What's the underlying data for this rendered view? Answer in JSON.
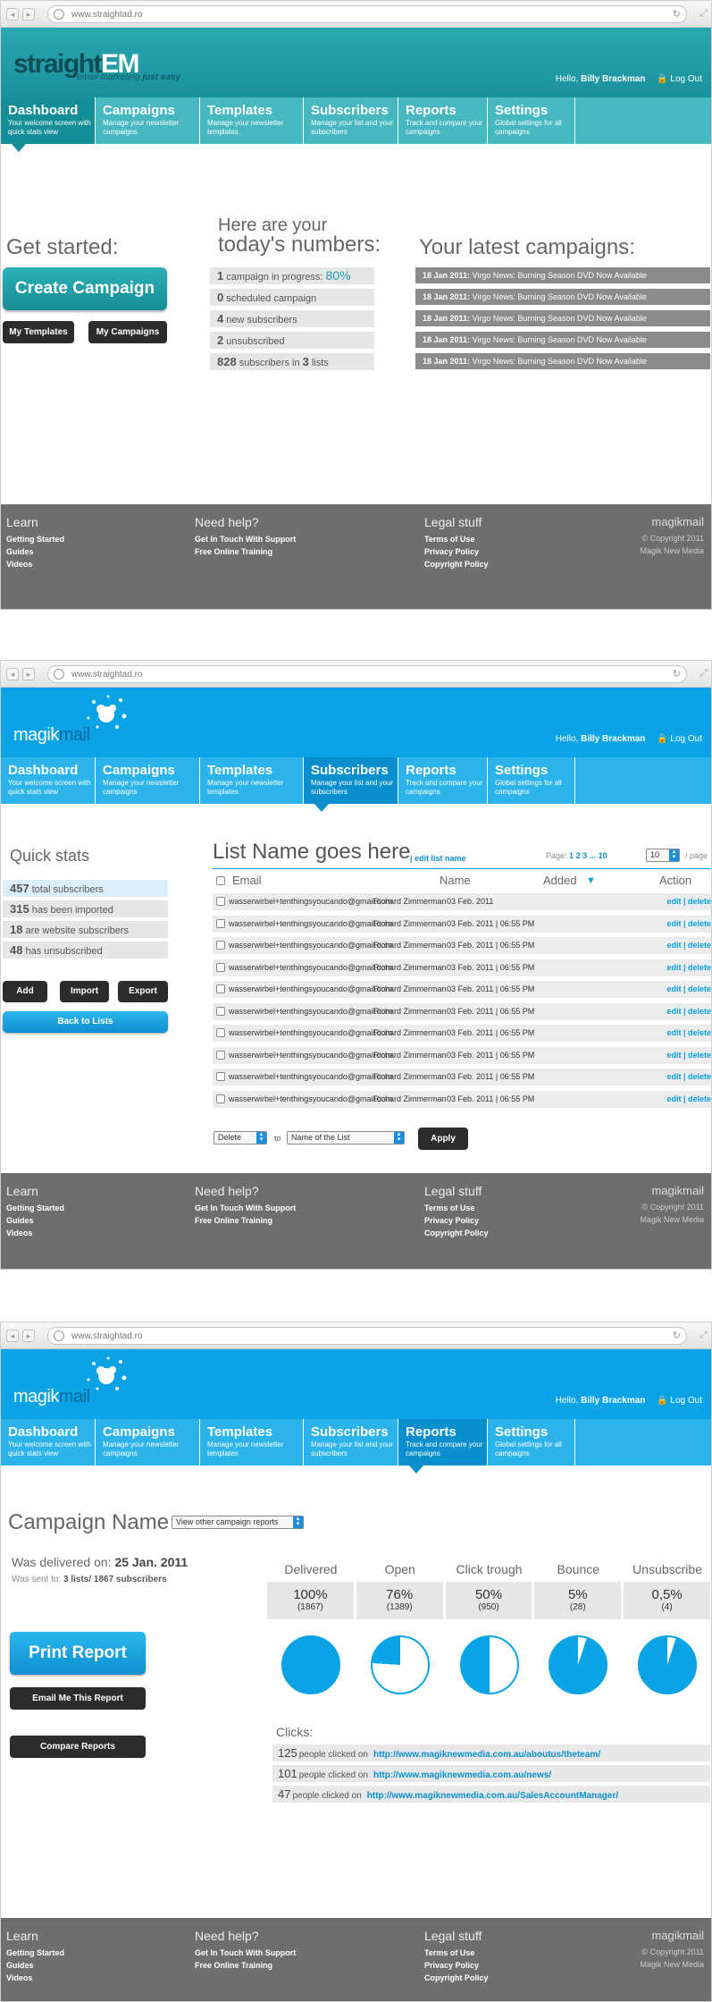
{
  "browser": {
    "url": "www.straightad.ro",
    "back": "◂",
    "fwd": "▸",
    "reload": "↻",
    "expand": "⤢"
  },
  "user": {
    "hello": "Hello,",
    "name": "Billy Brackman",
    "logout": "Log Out"
  },
  "nav": [
    {
      "title": "Dashboard",
      "sub": "Your welcome screen with quick stats view"
    },
    {
      "title": "Campaigns",
      "sub": "Manage your newsletter campaigns"
    },
    {
      "title": "Templates",
      "sub": "Manage your newsletter templates"
    },
    {
      "title": "Subscribers",
      "sub": "Manage your list and your subscribers"
    },
    {
      "title": "Reports",
      "sub": "Track and compare your campaigns"
    },
    {
      "title": "Settings",
      "sub": "Global settings for all campaigns"
    }
  ],
  "footer": {
    "learn": {
      "title": "Learn",
      "links": [
        "Getting Started",
        "Guides",
        "Videos"
      ]
    },
    "help": {
      "title": "Need help?",
      "links": [
        "Get In Touch With Support",
        "Free Online Training"
      ]
    },
    "legal": {
      "title": "Legal stuff",
      "links": [
        "Terms of Use",
        "Privacy Policy",
        "Copyright Policy"
      ]
    },
    "brand": {
      "name": "magikmail",
      "copyright": "© Copyright 2011",
      "company": "Magik New Media"
    }
  },
  "screen1": {
    "logo": {
      "straight": "straight",
      "em": "EM",
      "tag1": "email marketing",
      "tag2": "just easy"
    },
    "get_started": "Get started:",
    "create_campaign": "Create Campaign",
    "my_templates": "My Templates",
    "my_campaigns": "My Campaigns",
    "numbers_heading1": "Here are your",
    "numbers_heading2": "today's numbers:",
    "stats": [
      {
        "n": "1",
        "label": "campaign in progress:",
        "pct": "80%"
      },
      {
        "n": "0",
        "label": "scheduled campaign",
        "pct": ""
      },
      {
        "n": "4",
        "label": "new subscribers",
        "pct": ""
      },
      {
        "n": "2",
        "label": "unsubscribed",
        "pct": ""
      },
      {
        "n": "828",
        "label": "subscribers in",
        "n2": "3",
        "label2": "lists"
      }
    ],
    "latest_heading": "Your latest campaigns:",
    "campaigns": [
      {
        "date": "18 Jan 2011:",
        "title": "Virgo News: Burning Season DVD Now Available"
      },
      {
        "date": "18 Jan 2011:",
        "title": "Virgo News: Burning Season DVD Now Available"
      },
      {
        "date": "18 Jan 2011:",
        "title": "Virgo News: Burning Season DVD Now Available"
      },
      {
        "date": "18 Jan 2011:",
        "title": "Virgo News: Burning Season DVD Now Available"
      },
      {
        "date": "18 Jan 2011:",
        "title": "Virgo News: Burning Season DVD Now Available"
      }
    ]
  },
  "screen2": {
    "logo": {
      "magik": "magik",
      "mail": "mail"
    },
    "quick_stats": "Quick stats",
    "stats": [
      {
        "n": "457",
        "label": "total subscribers"
      },
      {
        "n": "315",
        "label": "has been imported"
      },
      {
        "n": "18",
        "label": "are website subscribers"
      },
      {
        "n": "48",
        "label": "has unsubscribed"
      }
    ],
    "add": "Add",
    "import": "Import",
    "export": "Export",
    "back": "Back to Lists",
    "list_name": "List Name goes here",
    "edit_list": "| edit list name",
    "page_label": "Page:",
    "pages": [
      "1",
      "2",
      "3",
      "...",
      "10"
    ],
    "per_page_value": "10",
    "per_page_label": "/ page",
    "columns": {
      "email": "Email",
      "name": "Name",
      "added": "Added",
      "action": "Action"
    },
    "rows": [
      {
        "email": "wasserwirbel+tenthingsyoucando@gmail.com",
        "name": "Richard Zimmerman",
        "added": "03 Feb. 2011",
        "action": "edit | delete"
      },
      {
        "email": "wasserwirbel+tenthingsyoucando@gmail.com",
        "name": "Richard Zimmerman",
        "added": "03 Feb. 2011 | 06:55 PM",
        "action": "edit | delete"
      },
      {
        "email": "wasserwirbel+tenthingsyoucando@gmail.com",
        "name": "Richard Zimmerman",
        "added": "03 Feb. 2011 | 06:55 PM",
        "action": "edit | delete"
      },
      {
        "email": "wasserwirbel+tenthingsyoucando@gmail.com",
        "name": "Richard Zimmerman",
        "added": "03 Feb. 2011 | 06:55 PM",
        "action": "edit | delete"
      },
      {
        "email": "wasserwirbel+tenthingsyoucando@gmail.com",
        "name": "Richard Zimmerman",
        "added": "03 Feb. 2011 | 06:55 PM",
        "action": "edit | delete"
      },
      {
        "email": "wasserwirbel+tenthingsyoucando@gmail.com",
        "name": "Richard Zimmerman",
        "added": "03 Feb. 2011 | 06:55 PM",
        "action": "edit | delete"
      },
      {
        "email": "wasserwirbel+tenthingsyoucando@gmail.com",
        "name": "Richard Zimmerman",
        "added": "03 Feb. 2011 | 06:55 PM",
        "action": "edit | delete"
      },
      {
        "email": "wasserwirbel+tenthingsyoucando@gmail.com",
        "name": "Richard Zimmerman",
        "added": "03 Feb. 2011 | 06:55 PM",
        "action": "edit | delete"
      },
      {
        "email": "wasserwirbel+tenthingsyoucando@gmail.com",
        "name": "Richard Zimmerman",
        "added": "03 Feb. 2011 | 06:55 PM",
        "action": "edit | delete"
      },
      {
        "email": "wasserwirbel+tenthingsyoucando@gmail.com",
        "name": "Richard Zimmerman",
        "added": "03 Feb. 2011 | 06:55 PM",
        "action": "edit | delete"
      }
    ],
    "bulk_action": "Delete",
    "to": "to",
    "target_list": "Name of the List",
    "apply": "Apply"
  },
  "screen3": {
    "campaign_name": "Campaign Name",
    "other_reports": "View other campaign reports",
    "delivered_label": "Was delivered on:",
    "delivered_date": "25 Jan. 2011",
    "sent_label": "Was sent to:",
    "sent_value": "3 lists/ 1867 subscribers",
    "print_report": "Print Report",
    "email_report": "Email Me This Report",
    "compare_reports": "Compare Reports",
    "metrics": [
      {
        "label": "Delivered",
        "pct": "100%",
        "count": "(1867)",
        "fraction": 1.0
      },
      {
        "label": "Open",
        "pct": "76%",
        "count": "(1389)",
        "fraction": 0.76
      },
      {
        "label": "Click trough",
        "pct": "50%",
        "count": "(950)",
        "fraction": 0.5
      },
      {
        "label": "Bounce",
        "pct": "5%",
        "count": "(28)",
        "fraction": 0.05
      },
      {
        "label": "Unsubscribe",
        "pct": "0,5%",
        "count": "(4)",
        "fraction": 0.05
      }
    ],
    "clicks_label": "Clicks:",
    "clicks": [
      {
        "n": "125",
        "text": "people clicked on",
        "url": "http://www.magiknewmedia.com.au/aboutus/theteam/"
      },
      {
        "n": "101",
        "text": "people clicked on",
        "url": "http://www.magiknewmedia.com.au/news/"
      },
      {
        "n": "47",
        "text": "people clicked on",
        "url": "http://www.magiknewmedia.com.au/SalesAccountManager/"
      }
    ]
  },
  "colors": {
    "accent_teal": "#1a919c",
    "accent_blue": "#0aa4e6",
    "link": "#0a8fce",
    "footer": "#6e6e6e"
  }
}
